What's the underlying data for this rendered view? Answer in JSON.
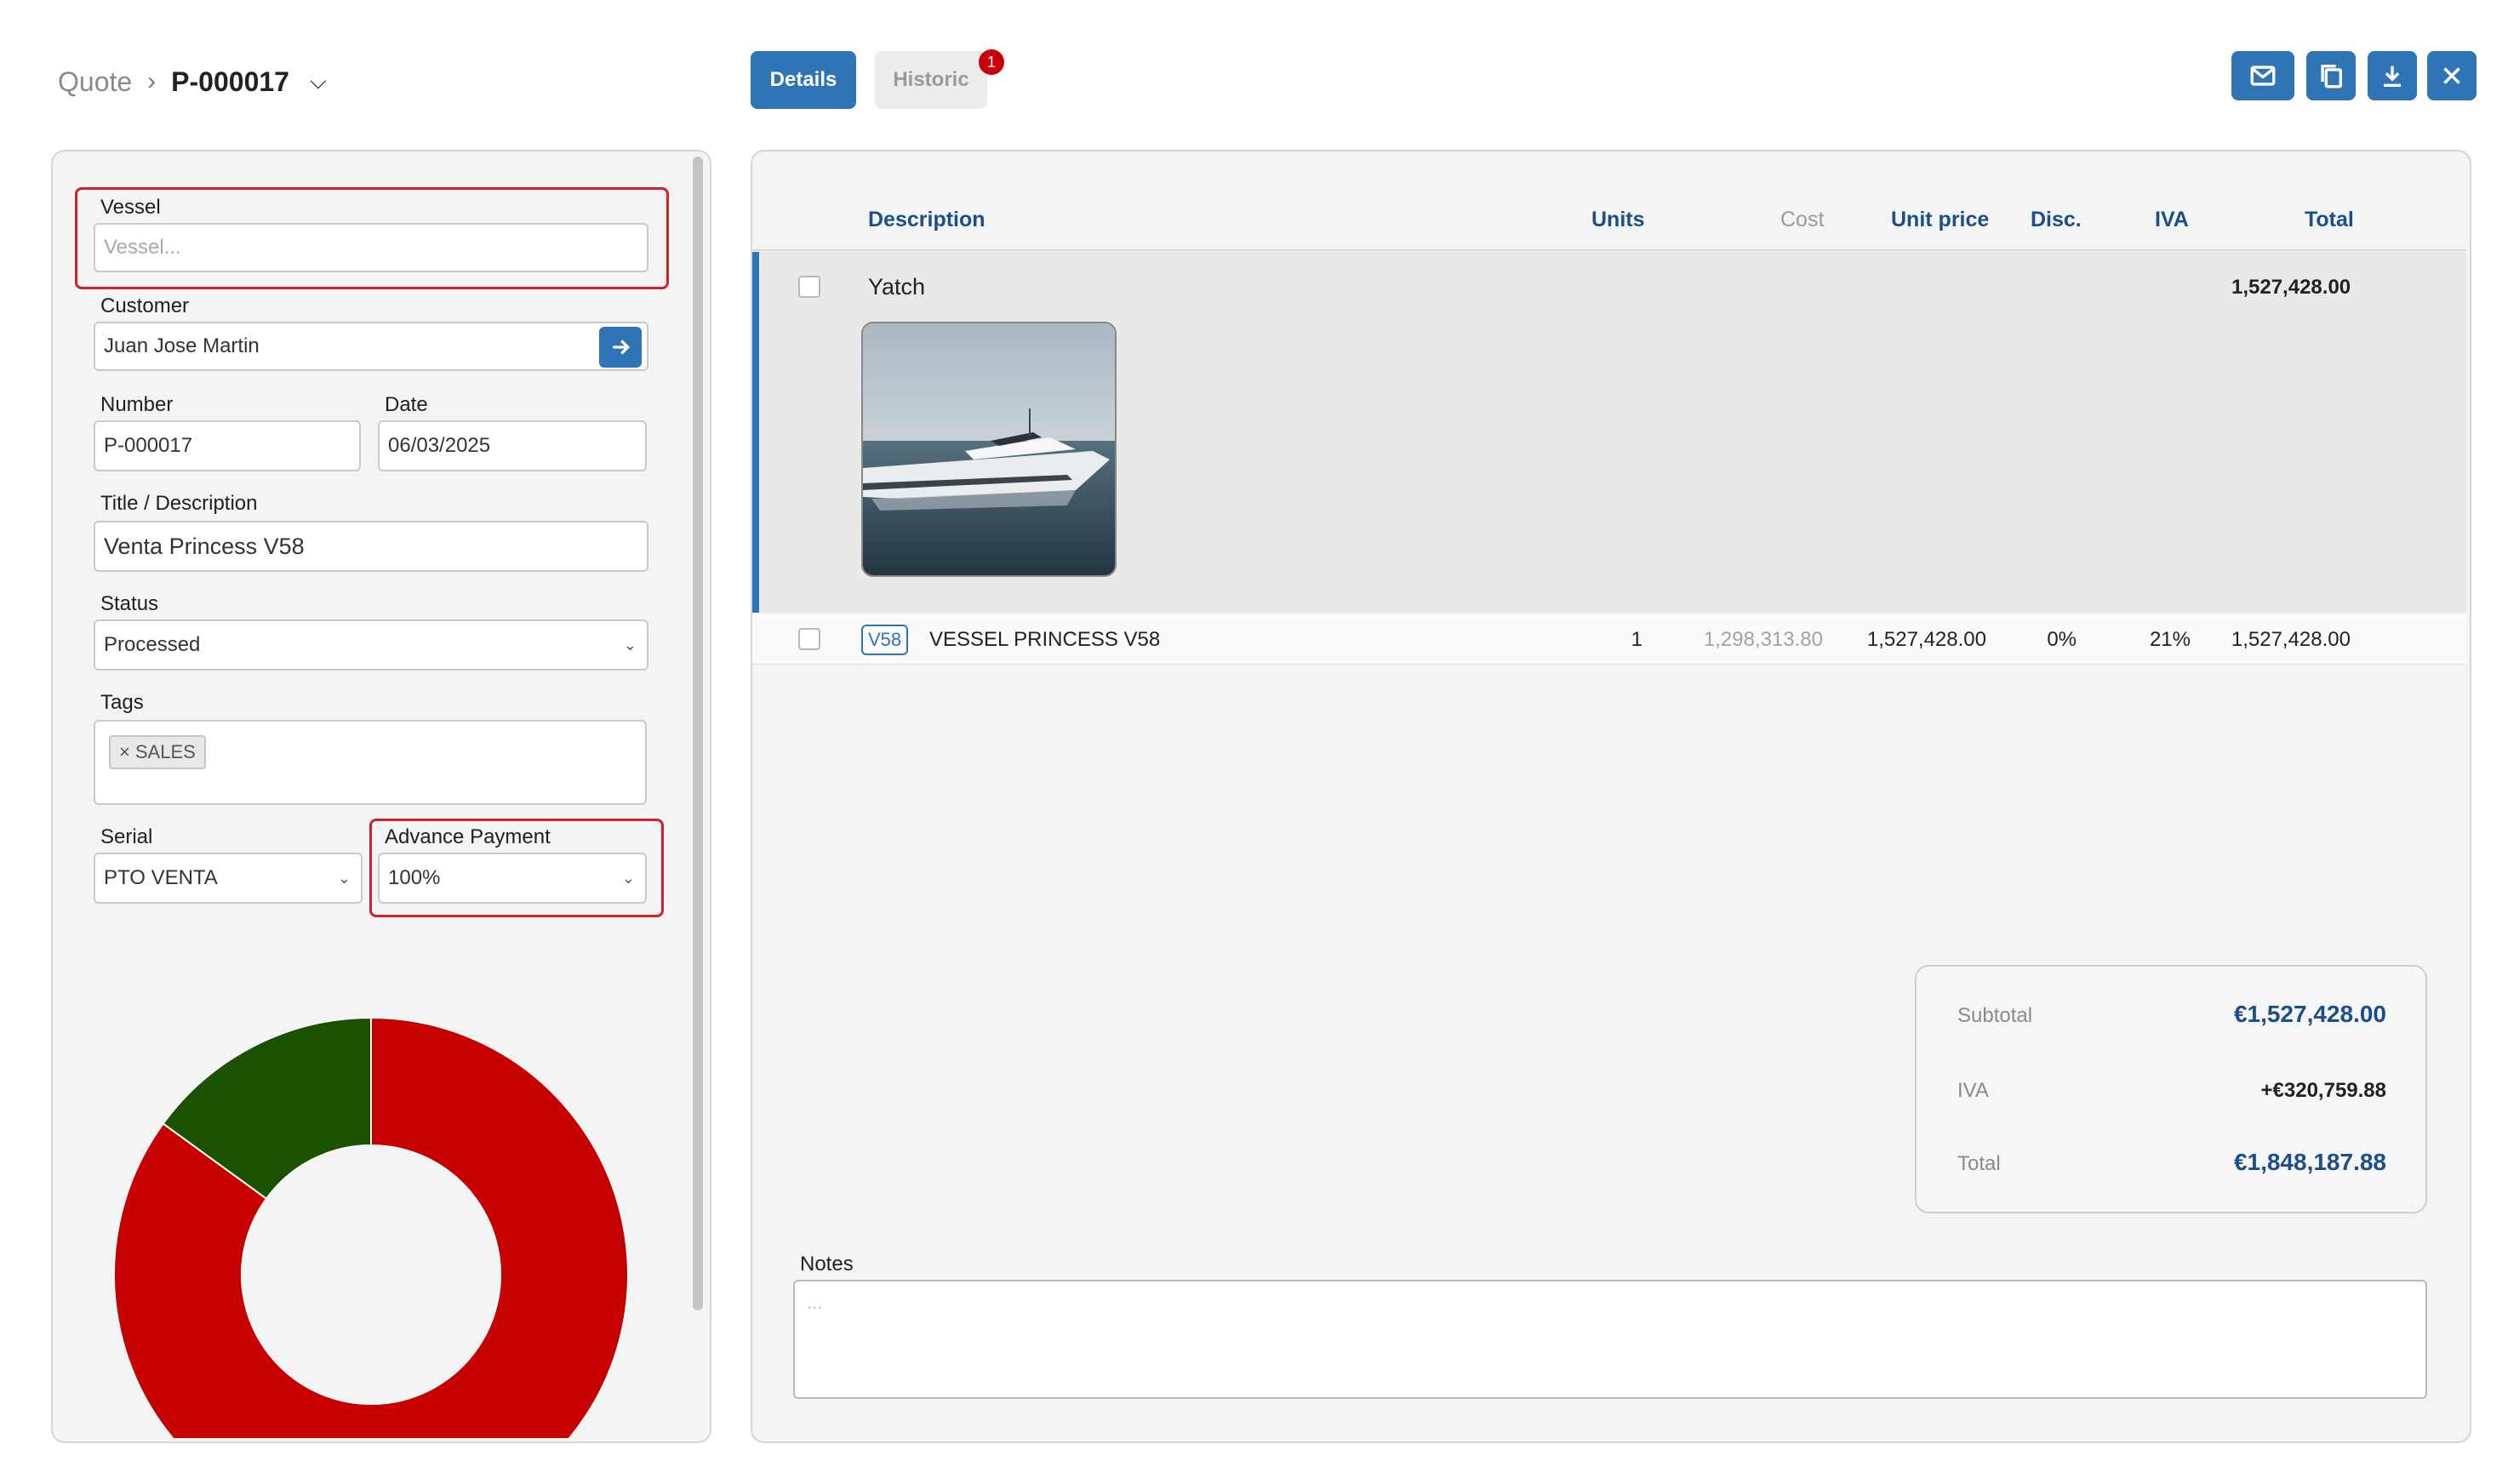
{
  "breadcrumb": {
    "parent": "Quote",
    "separator": "›",
    "current": "P-000017"
  },
  "tabs": {
    "details": "Details",
    "historic": "Historic",
    "historic_badge": "1"
  },
  "toolbar": [
    "mail-icon",
    "copy-icon",
    "download-icon",
    "close-icon"
  ],
  "form": {
    "vessel_label": "Vessel",
    "vessel_placeholder": "Vessel...",
    "customer_label": "Customer",
    "customer_value": "Juan Jose Martin",
    "number_label": "Number",
    "number_value": "P-000017",
    "date_label": "Date",
    "date_value": "06/03/2025",
    "title_label": "Title / Description",
    "title_value": "Venta Princess V58",
    "status_label": "Status",
    "status_value": "Processed",
    "tags_label": "Tags",
    "tags": [
      "SALES"
    ],
    "tag_remove": "×",
    "serial_label": "Serial",
    "serial_value": "PTO VENTA",
    "advance_label": "Advance Payment",
    "advance_value": "100%"
  },
  "chart_data": {
    "type": "pie",
    "donut": true,
    "slices": [
      {
        "label": "",
        "value": 85,
        "color": "#c70000"
      },
      {
        "label": "",
        "value": 15,
        "color": "#1a5200"
      }
    ]
  },
  "table": {
    "headers": {
      "description": "Description",
      "units": "Units",
      "cost": "Cost",
      "unit_price": "Unit price",
      "disc": "Disc.",
      "iva": "IVA",
      "total": "Total"
    },
    "group": {
      "name": "Yatch",
      "total": "1,527,428.00"
    },
    "rows": [
      {
        "code": "V58",
        "description": "VESSEL PRINCESS V58",
        "units": "1",
        "cost": "1,298,313.80",
        "unit_price": "1,527,428.00",
        "disc": "0%",
        "iva": "21%",
        "total": "1,527,428.00"
      }
    ]
  },
  "totals": {
    "subtotal_label": "Subtotal",
    "subtotal_value": "€1,527,428.00",
    "iva_label": "IVA",
    "iva_value": "+€320,759.88",
    "total_label": "Total",
    "total_value": "€1,848,187.88"
  },
  "notes": {
    "label": "Notes",
    "placeholder": "..."
  },
  "colors": {
    "accent": "#2f74b5",
    "highlight_border": "#d1202c",
    "badge": "#c8000a"
  }
}
